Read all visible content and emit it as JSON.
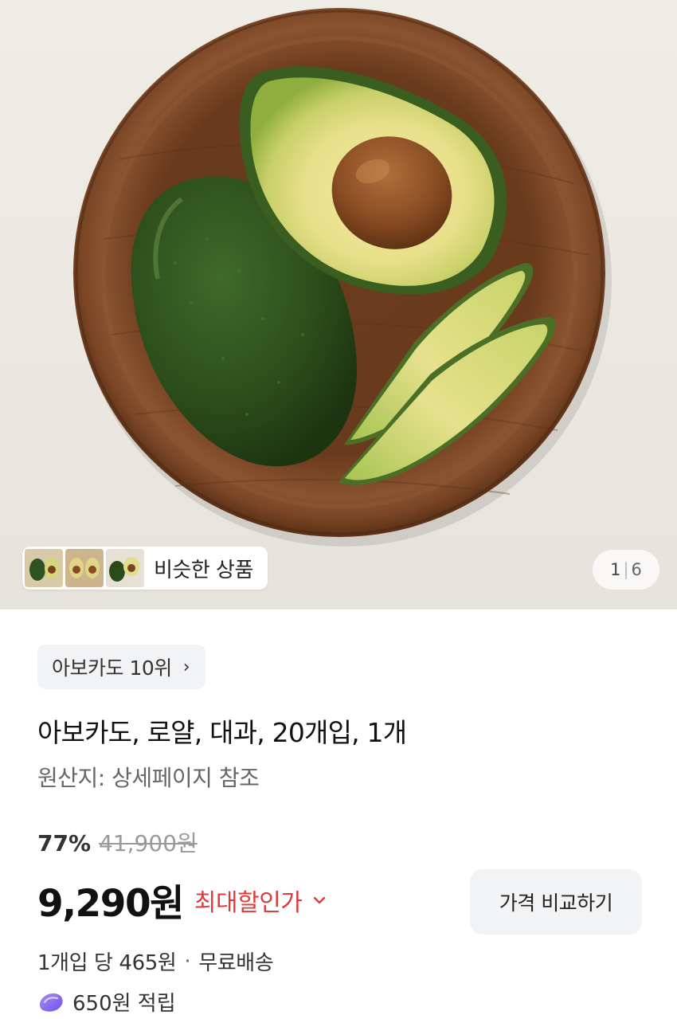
{
  "hero": {
    "similar_label": "비슷한 상품",
    "page_current": "1",
    "page_separator": "|",
    "page_total": "6"
  },
  "product": {
    "rank_label": "아보카도 10위",
    "rank_chevron": "›",
    "title": "아보카도, 로얄, 대과, 20개입, 1개",
    "origin": "원산지: 상세페이지 참조",
    "discount_rate": "77%",
    "original_price": "41,900원",
    "price": "9,290원",
    "max_discount_label": "최대할인가",
    "compare_button": "가격 비교하기",
    "unit_price": "1개입 당 465원",
    "unit_separator": "·",
    "shipping": "무료배송",
    "points": "650원 적립"
  },
  "colors": {
    "accent_red": "#e03b3b",
    "points_purple": "#8a6cf0"
  },
  "icons": {
    "rank_chevron": "chevron-right-icon",
    "discount_chevron": "chevron-down-icon",
    "points": "points-coin-icon"
  }
}
